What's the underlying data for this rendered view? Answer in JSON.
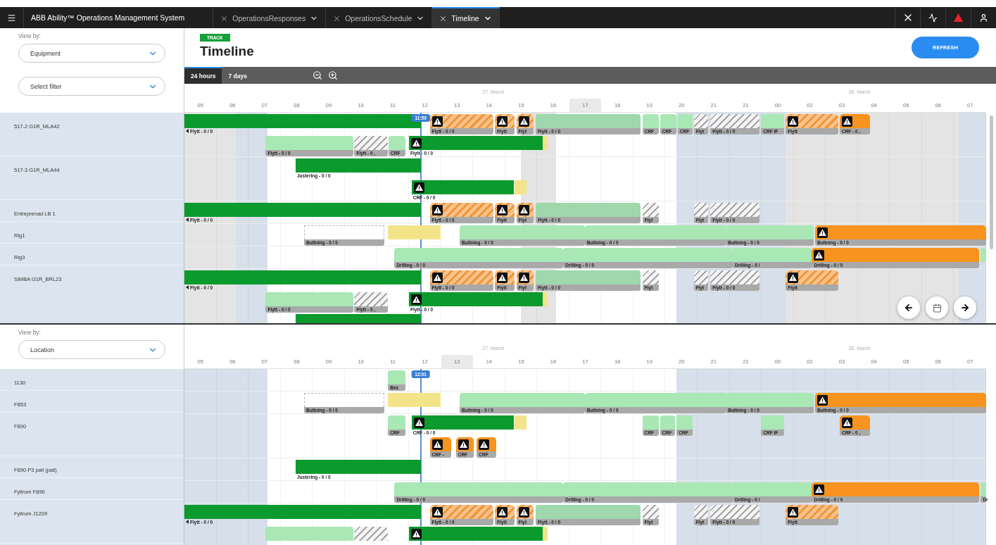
{
  "app_bar": {
    "title": "ABB Ability™ Operations Management System",
    "tabs": [
      {
        "label": "OperationsResponses",
        "selected": false
      },
      {
        "label": "OperationsSchedule",
        "selected": false
      },
      {
        "label": "Timeline",
        "selected": true
      }
    ]
  },
  "panels": [
    {
      "view_by": {
        "label": "View by:",
        "value": "Equipment"
      },
      "filter": {
        "placeholder": "Select filter"
      },
      "badge": "TRACK",
      "title": "Timeline",
      "refresh": "REFRESH",
      "ranges": [
        {
          "label": "24 hours",
          "selected": true
        },
        {
          "label": "7 days",
          "selected": false
        }
      ],
      "dates": [
        "27. March",
        "28. March"
      ],
      "hours": [
        {
          "label": "05",
          "highlighted": false
        },
        {
          "label": "06",
          "highlighted": false
        },
        {
          "label": "07",
          "highlighted": false
        },
        {
          "label": "08",
          "highlighted": false
        },
        {
          "label": "09",
          "highlighted": false
        },
        {
          "label": "10",
          "highlighted": false
        },
        {
          "label": "11",
          "highlighted": false
        },
        {
          "label": "12",
          "highlighted": false
        },
        {
          "label": "13",
          "highlighted": false
        },
        {
          "label": "14",
          "highlighted": false
        },
        {
          "label": "15",
          "highlighted": false
        },
        {
          "label": "16",
          "highlighted": false
        },
        {
          "label": "17",
          "highlighted": true
        },
        {
          "label": "18",
          "highlighted": false
        },
        {
          "label": "19",
          "highlighted": false
        },
        {
          "label": "20",
          "highlighted": false
        },
        {
          "label": "21",
          "highlighted": false
        },
        {
          "label": "21",
          "highlighted": false
        },
        {
          "label": "00",
          "highlighted": false
        },
        {
          "label": "02",
          "highlighted": false
        },
        {
          "label": "03",
          "highlighted": false
        },
        {
          "label": "04",
          "highlighted": false
        },
        {
          "label": "05",
          "highlighted": false
        },
        {
          "label": "06",
          "highlighted": false
        },
        {
          "label": "07",
          "highlighted": false
        }
      ],
      "now": "11:59",
      "nav": true,
      "rows": [
        {
          "name": "517-2 G1R_MLA42",
          "lanes": [
            [
              {
                "kind": "done",
                "label": "Flytt - 0 / 0",
                "warning": false,
                "clipped": true
              },
              {
                "kind": "warning_hatched",
                "label": "Flytt - 0 / 0",
                "warning": true,
                "clipped": false
              },
              {
                "kind": "warning_hatched",
                "label": "Flytt",
                "warning": true,
                "clipped": false
              },
              {
                "kind": "warning_hatched",
                "label": "Flyt",
                "warning": true,
                "clipped": false
              },
              {
                "kind": "planned_dim",
                "label": "Flytt - 0 / 0",
                "warning": false,
                "clipped": false
              },
              {
                "kind": "planned",
                "label": "CRF",
                "warning": false,
                "clipped": false
              },
              {
                "kind": "planned",
                "label": "CRF",
                "warning": false,
                "clipped": false
              },
              {
                "kind": "planned",
                "label": "CRF",
                "warning": false,
                "clipped": false
              },
              {
                "kind": "hatched",
                "label": "Flyt",
                "warning": false,
                "clipped": false
              },
              {
                "kind": "hatched",
                "label": "Flytt - 0 / 0",
                "warning": false,
                "clipped": false
              },
              {
                "kind": "planned",
                "label": "CRF IF",
                "warning": false,
                "clipped": false
              },
              {
                "kind": "warning_hatched",
                "label": "Flytt",
                "warning": true,
                "clipped": false
              },
              {
                "kind": "alert",
                "label": "CRF - 0 ,",
                "warning": true,
                "clipped": false
              }
            ],
            [
              {
                "kind": "planned",
                "label": "Flytt - 0 / 0",
                "warning": false,
                "clipped": false
              },
              {
                "kind": "hatched",
                "label": "Flytt - 0 ,",
                "warning": false,
                "clipped": false
              },
              {
                "kind": "planned",
                "label": "CRF",
                "warning": false,
                "clipped": false
              },
              {
                "kind": "done",
                "label": "Flytt - 0 / 0",
                "warning": true,
                "clipped": false
              },
              {
                "kind": "pending",
                "warning": false,
                "clipped": false
              }
            ]
          ]
        },
        {
          "name": "517-3 G1R_MLA44",
          "lanes": [
            [
              {
                "kind": "done",
                "label": "Justering - 0 / 0",
                "warning": false,
                "clipped": false
              }
            ],
            [
              {
                "kind": "done",
                "label": "CRF - 0 / 0",
                "warning": true,
                "clipped": false
              },
              {
                "kind": "pending",
                "warning": false,
                "clipped": false
              }
            ]
          ]
        },
        {
          "name": "Entreprenad LB 1",
          "lanes": [
            [
              {
                "kind": "done",
                "label": "Flytt - 0 / 0",
                "warning": false,
                "clipped": true
              },
              {
                "kind": "warning_hatched",
                "label": "Flytt - 0 / 0",
                "warning": true,
                "clipped": false
              },
              {
                "kind": "warning_hatched",
                "label": "Flytt",
                "warning": true,
                "clipped": false
              },
              {
                "kind": "warning_hatched",
                "label": "Flyt",
                "warning": true,
                "clipped": false
              },
              {
                "kind": "planned_dim",
                "label": "Flytt - 0 / 0",
                "warning": false,
                "clipped": false
              },
              {
                "kind": "hatched",
                "label": "Flyt",
                "warning": false,
                "clipped": false
              },
              {
                "kind": "hatched",
                "label": "Flyt",
                "warning": false,
                "clipped": false
              },
              {
                "kind": "hatched",
                "label": "Flytt - 0 / 0",
                "warning": false,
                "clipped": false
              }
            ]
          ]
        },
        {
          "name": "Rig1",
          "lanes": [
            [
              {
                "kind": "ghost",
                "label": "Bultning - 0 / 0",
                "warning": false,
                "clipped": false
              },
              {
                "kind": "pending",
                "warning": false,
                "clipped": false
              },
              {
                "kind": "planned",
                "label": "Bultning - 0 / 0",
                "warning": false,
                "clipped": false
              },
              {
                "kind": "planned",
                "label": "Bultning - 0 / 0",
                "warning": false,
                "clipped": false
              },
              {
                "kind": "planned",
                "label": "Bultning - 0 / 0",
                "warning": false,
                "clipped": false
              },
              {
                "kind": "alert",
                "label": "Bultning - 0 / 0",
                "warning": true,
                "clipped": false
              }
            ]
          ]
        },
        {
          "name": "Rig3",
          "lanes": [
            [
              {
                "kind": "planned",
                "label": "Drilling - 0 / 0",
                "warning": false,
                "clipped": false
              },
              {
                "kind": "planned",
                "label": "Drilling - 0 / 0",
                "warning": false,
                "clipped": false
              },
              {
                "kind": "planned",
                "label": "Drilling - 0 /",
                "warning": false,
                "clipped": false
              },
              {
                "kind": "alert",
                "label": "Drilling - 0 / 0",
                "warning": true,
                "clipped": false
              },
              {
                "kind": "planned",
                "warning": false,
                "clipped": false
              }
            ]
          ]
        },
        {
          "name": "SIMBA G1R_BRL23",
          "lanes": [
            [
              {
                "kind": "done",
                "label": "Flytt - 0 / 0",
                "warning": false,
                "clipped": true
              },
              {
                "kind": "warning_hatched",
                "label": "Flytt - 0 / 0",
                "warning": true,
                "clipped": false
              },
              {
                "kind": "warning_hatched",
                "label": "Flytt",
                "warning": true,
                "clipped": false
              },
              {
                "kind": "warning_hatched",
                "label": "Flyt",
                "warning": true,
                "clipped": false
              },
              {
                "kind": "planned_dim",
                "label": "Flytt - 0 / 0",
                "warning": false,
                "clipped": false
              },
              {
                "kind": "hatched",
                "label": "Flyt",
                "warning": false,
                "clipped": false
              },
              {
                "kind": "hatched",
                "label": "Flyt",
                "warning": false,
                "clipped": false
              },
              {
                "kind": "hatched",
                "label": "Flytt - 0 / 0",
                "warning": false,
                "clipped": false
              },
              {
                "kind": "warning_hatched",
                "label": "Flytt",
                "warning": true,
                "clipped": false
              }
            ],
            [
              {
                "kind": "planned",
                "label": "Flytt - 0 / 0",
                "warning": false,
                "clipped": false
              },
              {
                "kind": "hatched",
                "label": "Flytt - 0 ,",
                "warning": false,
                "clipped": false
              },
              {
                "kind": "done",
                "label": "Flytt - 0 / 0",
                "warning": true,
                "clipped": false
              },
              {
                "kind": "pending",
                "warning": false,
                "clipped": false
              }
            ],
            [
              {
                "kind": "done",
                "warning": false
              }
            ]
          ]
        }
      ]
    },
    {
      "view_by": {
        "label": "View by:",
        "value": "Location"
      },
      "dates": [
        "27. March",
        "28. March"
      ],
      "hours": [
        {
          "label": "05",
          "highlighted": false
        },
        {
          "label": "06",
          "highlighted": false
        },
        {
          "label": "07",
          "highlighted": false
        },
        {
          "label": "08",
          "highlighted": false
        },
        {
          "label": "09",
          "highlighted": false
        },
        {
          "label": "10",
          "highlighted": false
        },
        {
          "label": "11",
          "highlighted": false
        },
        {
          "label": "12",
          "highlighted": false
        },
        {
          "label": "13",
          "highlighted": true
        },
        {
          "label": "14",
          "highlighted": false
        },
        {
          "label": "15",
          "highlighted": false
        },
        {
          "label": "16",
          "highlighted": false
        },
        {
          "label": "17",
          "highlighted": false
        },
        {
          "label": "18",
          "highlighted": false
        },
        {
          "label": "19",
          "highlighted": false
        },
        {
          "label": "20",
          "highlighted": false
        },
        {
          "label": "21",
          "highlighted": false
        },
        {
          "label": "21",
          "highlighted": false
        },
        {
          "label": "00",
          "highlighted": false
        },
        {
          "label": "02",
          "highlighted": false
        },
        {
          "label": "03",
          "highlighted": false
        },
        {
          "label": "04",
          "highlighted": false
        },
        {
          "label": "05",
          "highlighted": false
        },
        {
          "label": "06",
          "highlighted": false
        },
        {
          "label": "07",
          "highlighted": false
        }
      ],
      "now": "12:01",
      "nav": false,
      "rows": [
        {
          "name": "1130",
          "lanes": [
            [
              {
                "kind": "planned",
                "label": "Bes",
                "warning": false,
                "clipped": false
              }
            ]
          ]
        },
        {
          "name": "F853",
          "lanes": [
            [
              {
                "kind": "ghost",
                "label": "Bultning - 0 / 0",
                "warning": false,
                "clipped": false
              },
              {
                "kind": "pending",
                "warning": false,
                "clipped": false
              },
              {
                "kind": "planned",
                "label": "Bultning - 0 / 0",
                "warning": false,
                "clipped": false
              },
              {
                "kind": "planned",
                "label": "Bultning - 0 / 0",
                "warning": false,
                "clipped": false
              },
              {
                "kind": "planned",
                "label": "Bultning - 0 / 0",
                "warning": false,
                "clipped": false
              },
              {
                "kind": "alert",
                "label": "Bultning - 0 / 0",
                "warning": true,
                "clipped": false
              }
            ]
          ]
        },
        {
          "name": "F890",
          "lanes": [
            [
              {
                "kind": "planned",
                "label": "CRF",
                "warning": false,
                "clipped": false
              },
              {
                "kind": "done",
                "label": "CRF - 0 / 0",
                "warning": true,
                "clipped": false
              },
              {
                "kind": "pending",
                "warning": false,
                "clipped": false
              },
              {
                "kind": "planned",
                "label": "CRF",
                "warning": false,
                "clipped": false
              },
              {
                "kind": "planned",
                "label": "CRF",
                "warning": false,
                "clipped": false
              },
              {
                "kind": "planned",
                "label": "CRF",
                "warning": false,
                "clipped": false
              },
              {
                "kind": "planned",
                "label": "CRF IF",
                "warning": false,
                "clipped": false
              },
              {
                "kind": "alert",
                "label": "CRF - 0 ,",
                "warning": true,
                "clipped": false
              }
            ],
            [
              {
                "kind": "alert",
                "label": "CRF -",
                "warning": true,
                "clipped": false
              },
              {
                "kind": "alert",
                "label": "CRF",
                "warning": true,
                "clipped": false
              },
              {
                "kind": "alert",
                "label": "CRF",
                "warning": true,
                "clipped": false
              }
            ]
          ]
        },
        {
          "name": "F890 P3 pall (pall)",
          "lanes": [
            [
              {
                "kind": "done",
                "label": "Justering - 0 / 0",
                "warning": false,
                "clipped": false
              }
            ]
          ]
        },
        {
          "name": "Fyllrum F890",
          "lanes": [
            [
              {
                "kind": "planned",
                "label": "Drilling - 0 / 0",
                "warning": false,
                "clipped": false
              },
              {
                "kind": "planned",
                "label": "Drilling - 0 / 0",
                "warning": false,
                "clipped": false
              },
              {
                "kind": "planned",
                "label": "Drilling - 0 /",
                "warning": false,
                "clipped": false
              },
              {
                "kind": "alert",
                "label": "Drilling - 0 / 0",
                "warning": true,
                "clipped": false
              },
              {
                "kind": "planned",
                "label": "Dr",
                "warning": false,
                "clipped": false
              }
            ]
          ]
        },
        {
          "name": "Fyllrum J1209",
          "lanes": [
            [
              {
                "kind": "done",
                "label": "Flytt - 0 / 0",
                "warning": false,
                "clipped": true
              },
              {
                "kind": "warning_hatched",
                "label": "Flytt - 0 / 0",
                "warning": true,
                "clipped": false
              },
              {
                "kind": "warning_hatched",
                "label": "Flytt",
                "warning": true,
                "clipped": false
              },
              {
                "kind": "warning_hatched",
                "label": "Flyt",
                "warning": true,
                "clipped": false
              },
              {
                "kind": "planned_dim",
                "label": "Flytt - 0 / 0",
                "warning": false,
                "clipped": false
              },
              {
                "kind": "hatched",
                "label": "Flyt",
                "warning": false,
                "clipped": false
              },
              {
                "kind": "hatched",
                "label": "Flyt",
                "warning": false,
                "clipped": false
              },
              {
                "kind": "hatched",
                "label": "Flytt - 0 / 0",
                "warning": false,
                "clipped": false
              },
              {
                "kind": "warning_hatched",
                "label": "Flytt",
                "warning": true,
                "clipped": false
              }
            ],
            [
              {
                "kind": "planned",
                "warning": false,
                "clipped": false
              },
              {
                "kind": "hatched",
                "warning": false,
                "clipped": false
              },
              {
                "kind": "done",
                "warning": true,
                "clipped": false
              },
              {
                "kind": "pending",
                "warning": false,
                "clipped": false
              }
            ]
          ]
        }
      ]
    }
  ]
}
